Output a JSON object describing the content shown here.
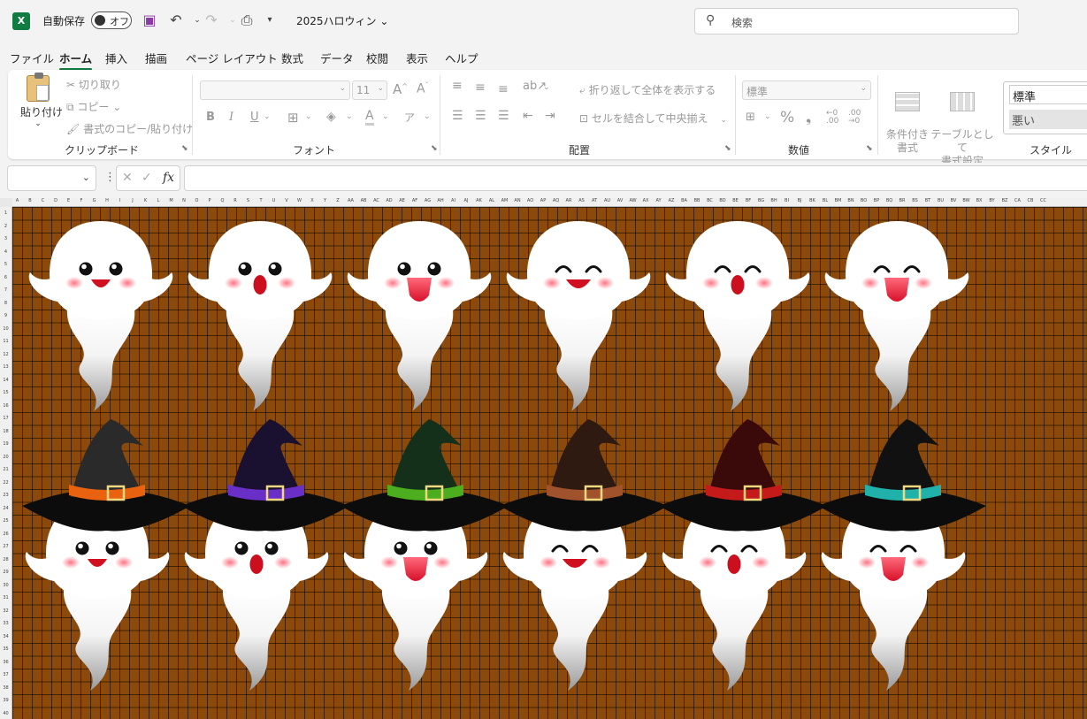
{
  "titlebar": {
    "autosave_label": "自動保存",
    "autosave_state": "オフ",
    "filename": "2025ハロウィン",
    "search_placeholder": "検索"
  },
  "tabs": [
    "ファイル",
    "ホーム",
    "挿入",
    "描画",
    "ページ レイアウト",
    "数式",
    "データ",
    "校閲",
    "表示",
    "ヘルプ"
  ],
  "active_tab": "ホーム",
  "ribbon": {
    "clipboard": {
      "label": "クリップボード",
      "paste": "貼り付け",
      "cut": "切り取り",
      "copy": "コピー",
      "format_painter": "書式のコピー/貼り付け"
    },
    "font": {
      "label": "フォント",
      "size": "11"
    },
    "alignment": {
      "label": "配置",
      "wrap_text": "折り返して全体を表示する",
      "merge_center": "セルを結合して中央揃え"
    },
    "number": {
      "label": "数値",
      "format": "標準"
    },
    "styles": {
      "label": "スタイル",
      "conditional": "条件付き\n書式",
      "table": "テーブルとして\n書式設定",
      "style_normal": "標準",
      "style_bad": "悪い"
    }
  },
  "formula_bar": {
    "fx": "fx"
  },
  "sheet": {
    "column_headers": [
      "A",
      "B",
      "C",
      "D",
      "E",
      "F",
      "G",
      "H",
      "I",
      "J",
      "K",
      "L",
      "M",
      "N",
      "O",
      "P",
      "Q",
      "R",
      "S",
      "T",
      "U",
      "V",
      "W",
      "X",
      "Y",
      "Z",
      "AA",
      "AB",
      "AC",
      "AD",
      "AE",
      "AF",
      "AG",
      "AH",
      "AI",
      "AJ",
      "AK",
      "AL",
      "AM",
      "AN",
      "AO",
      "AP",
      "AQ",
      "AR",
      "AS",
      "AT",
      "AU",
      "AV",
      "AW",
      "AX",
      "AY",
      "AZ",
      "BA",
      "BB",
      "BC",
      "BD",
      "BE",
      "BF",
      "BG",
      "BH",
      "BI",
      "BJ",
      "BK",
      "BL",
      "BM",
      "BN",
      "BO",
      "BP",
      "BQ",
      "BR",
      "BS",
      "BT",
      "BU",
      "BV",
      "BW",
      "BX",
      "BY",
      "BZ",
      "CA",
      "CB",
      "CC"
    ],
    "row_headers": [
      "1",
      "2",
      "3",
      "4",
      "5",
      "6",
      "7",
      "8",
      "9",
      "10",
      "11",
      "12",
      "13",
      "14",
      "15",
      "16",
      "17",
      "18",
      "19",
      "20",
      "21",
      "22",
      "23",
      "24",
      "25",
      "26",
      "27",
      "28",
      "29",
      "30",
      "31",
      "32",
      "33",
      "34",
      "35",
      "36",
      "37",
      "38",
      "39",
      "40"
    ],
    "background_color": "#8b4a0c",
    "top_row_faces": [
      "smile-eyes-open",
      "surprised-eyes-open",
      "tongue-eyes-open",
      "grin-eyes-closed",
      "surprised-eyes-closed",
      "tongue-eyes-closed"
    ],
    "hat_band_colors": [
      "#e8620f",
      "#6a2fc7",
      "#4cae1e",
      "#a0522d",
      "#c41a1a",
      "#20b2aa"
    ],
    "hat_colors": [
      "#2a2a2a",
      "#1a1030",
      "#15301a",
      "#2e1a10",
      "#3a0a0a",
      "#111111"
    ],
    "bottom_row_faces": [
      "smile-eyes-open",
      "surprised-eyes-open",
      "tongue-eyes-open",
      "grin-eyes-closed",
      "surprised-eyes-closed",
      "tongue-eyes-closed"
    ]
  }
}
